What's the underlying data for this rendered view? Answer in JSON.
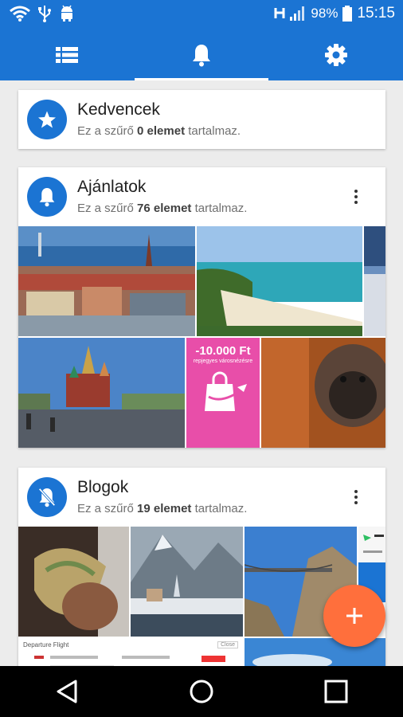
{
  "status_bar": {
    "battery_percent": "98%",
    "time": "15:15",
    "icons": [
      "wifi-icon",
      "usb-icon",
      "android-icon",
      "h-signal-icon",
      "signal-bars-icon",
      "battery-icon"
    ]
  },
  "tabs": [
    {
      "name": "list-icon",
      "active": false
    },
    {
      "name": "bell-icon",
      "active": true
    },
    {
      "name": "gear-icon",
      "active": false
    }
  ],
  "cards": [
    {
      "title": "Kedvencek",
      "sub_prefix": "Ez a szűrő ",
      "count_text": "0 elemet",
      "sub_suffix": " tartalmaz.",
      "icon": "star-icon"
    },
    {
      "title": "Ajánlatok",
      "sub_prefix": "Ez a szűrő ",
      "count_text": "76 elemet",
      "sub_suffix": " tartalmaz.",
      "icon": "bell-icon"
    },
    {
      "title": "Blogok",
      "sub_prefix": "Ez a szűrő ",
      "count_text": "19 elemet",
      "sub_suffix": " tartalmaz.",
      "icon": "bell-off-icon"
    }
  ],
  "promo": {
    "price": "-10.000 Ft",
    "sub": "repjegyes városnézésre"
  },
  "flight_card": {
    "label": "Departure Flight",
    "button": "Close"
  },
  "fab_icon": "plus-icon",
  "colors": {
    "primary": "#1b74d3",
    "accent": "#ff6f3c",
    "promo": "#e84ea9"
  }
}
